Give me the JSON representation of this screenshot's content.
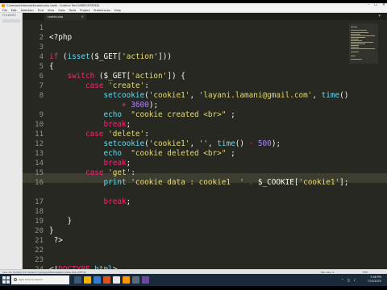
{
  "window": {
    "title": "C:\\xampp\\htdocs\\web\\cookie.php (web) - Sublime Text (UNREGISTERED)",
    "buttons": [
      "–",
      "☐",
      "✕"
    ]
  },
  "menu": [
    "File",
    "Edit",
    "Selection",
    "Find",
    "View",
    "Goto",
    "Tools",
    "Project",
    "Preferences",
    "Help"
  ],
  "sidebar": {
    "label": "FOLDERS"
  },
  "tab": {
    "label": "cookie.php",
    "close": "×"
  },
  "editor": {
    "current_line": 14,
    "lines": [
      {
        "n": "1",
        "segments": []
      },
      {
        "n": "2",
        "segments": [
          {
            "t": "<?php",
            "c": "w"
          }
        ]
      },
      {
        "n": "3",
        "segments": []
      },
      {
        "n": "4",
        "segments": [
          {
            "t": "if",
            "c": "k"
          },
          {
            "t": " (",
            "c": "w"
          },
          {
            "t": "isset",
            "c": "f"
          },
          {
            "t": "($_GET[",
            "c": "w"
          },
          {
            "t": "'action'",
            "c": "s"
          },
          {
            "t": "]))",
            "c": "w"
          }
        ]
      },
      {
        "n": "5",
        "segments": [
          {
            "t": "{",
            "c": "w"
          }
        ]
      },
      {
        "n": "6",
        "segments": [
          {
            "t": "    ",
            "c": "w"
          },
          {
            "t": "switch",
            "c": "k"
          },
          {
            "t": " ($_GET[",
            "c": "w"
          },
          {
            "t": "'action'",
            "c": "s"
          },
          {
            "t": "]) {",
            "c": "w"
          }
        ]
      },
      {
        "n": "7",
        "segments": [
          {
            "t": "        ",
            "c": "w"
          },
          {
            "t": "case",
            "c": "k"
          },
          {
            "t": " ",
            "c": "w"
          },
          {
            "t": "'create'",
            "c": "s"
          },
          {
            "t": ":",
            "c": "w"
          }
        ]
      },
      {
        "n": "8",
        "segments": [
          {
            "t": "            ",
            "c": "w"
          },
          {
            "t": "setcookie",
            "c": "f"
          },
          {
            "t": "(",
            "c": "w"
          },
          {
            "t": "'cookie1'",
            "c": "s"
          },
          {
            "t": ", ",
            "c": "w"
          },
          {
            "t": "'layani.lamani@gmail.com'",
            "c": "s"
          },
          {
            "t": ", ",
            "c": "w"
          },
          {
            "t": "time",
            "c": "f"
          },
          {
            "t": "()",
            "c": "w"
          }
        ]
      },
      {
        "n": "",
        "segments": [
          {
            "t": "                ",
            "c": "w"
          },
          {
            "t": "+",
            "c": "k"
          },
          {
            "t": " ",
            "c": "w"
          },
          {
            "t": "3600",
            "c": "n"
          },
          {
            "t": ");",
            "c": "w"
          }
        ]
      },
      {
        "n": "9",
        "segments": [
          {
            "t": "            ",
            "c": "w"
          },
          {
            "t": "echo",
            "c": "f"
          },
          {
            "t": "  ",
            "c": "w"
          },
          {
            "t": "\"cookie created <br>\"",
            "c": "s"
          },
          {
            "t": " ;",
            "c": "w"
          }
        ]
      },
      {
        "n": "10",
        "segments": [
          {
            "t": "            ",
            "c": "w"
          },
          {
            "t": "break",
            "c": "k"
          },
          {
            "t": ";",
            "c": "w"
          }
        ]
      },
      {
        "n": "11",
        "segments": [
          {
            "t": "        ",
            "c": "w"
          },
          {
            "t": "case",
            "c": "k"
          },
          {
            "t": " ",
            "c": "w"
          },
          {
            "t": "'delete'",
            "c": "s"
          },
          {
            "t": ":",
            "c": "w"
          }
        ]
      },
      {
        "n": "12",
        "segments": [
          {
            "t": "            ",
            "c": "w"
          },
          {
            "t": "setcookie",
            "c": "f"
          },
          {
            "t": "(",
            "c": "w"
          },
          {
            "t": "'cookie1'",
            "c": "s"
          },
          {
            "t": ", ",
            "c": "w"
          },
          {
            "t": "''",
            "c": "s"
          },
          {
            "t": ", ",
            "c": "w"
          },
          {
            "t": "time",
            "c": "f"
          },
          {
            "t": "() ",
            "c": "w"
          },
          {
            "t": "-",
            "c": "k"
          },
          {
            "t": " ",
            "c": "w"
          },
          {
            "t": "500",
            "c": "n"
          },
          {
            "t": ");",
            "c": "w"
          }
        ]
      },
      {
        "n": "13",
        "segments": [
          {
            "t": "            ",
            "c": "w"
          },
          {
            "t": "echo",
            "c": "f"
          },
          {
            "t": "  ",
            "c": "w"
          },
          {
            "t": "\"cookie deleted <br>\"",
            "c": "s"
          },
          {
            "t": " ;",
            "c": "w"
          }
        ]
      },
      {
        "n": "14",
        "segments": [
          {
            "t": "            ",
            "c": "w"
          },
          {
            "t": "break",
            "c": "k"
          },
          {
            "t": ";",
            "c": "w"
          }
        ]
      },
      {
        "n": "15",
        "segments": [
          {
            "t": "        ",
            "c": "w"
          },
          {
            "t": "case",
            "c": "k"
          },
          {
            "t": " ",
            "c": "w"
          },
          {
            "t": "'get'",
            "c": "s"
          },
          {
            "t": ":",
            "c": "w"
          }
        ]
      },
      {
        "n": "16",
        "segments": [
          {
            "t": "            ",
            "c": "w"
          },
          {
            "t": "print",
            "c": "f"
          },
          {
            "t": " ",
            "c": "w"
          },
          {
            "t": "'cookie data : cookie1  '",
            "c": "s"
          },
          {
            "t": " ",
            "c": "w"
          },
          {
            "t": ".",
            "c": "k"
          },
          {
            "t": " $_COOKIE[",
            "c": "w"
          },
          {
            "t": "'cookie1'",
            "c": "s"
          },
          {
            "t": "];",
            "c": "w"
          }
        ]
      },
      {
        "n": "",
        "segments": []
      },
      {
        "n": "17",
        "segments": [
          {
            "t": "            ",
            "c": "w"
          },
          {
            "t": "break",
            "c": "k"
          },
          {
            "t": ";",
            "c": "w"
          }
        ]
      },
      {
        "n": "18",
        "segments": []
      },
      {
        "n": "19",
        "segments": [
          {
            "t": "    }",
            "c": "w"
          }
        ]
      },
      {
        "n": "20",
        "segments": [
          {
            "t": "}",
            "c": "w"
          }
        ]
      },
      {
        "n": "21",
        "segments": [
          {
            "t": " ?>",
            "c": "w"
          }
        ]
      },
      {
        "n": "22",
        "segments": []
      },
      {
        "n": "23",
        "segments": []
      },
      {
        "n": "24",
        "segments": [
          {
            "t": "<!",
            "c": "w"
          },
          {
            "t": "DOCTYPE",
            "c": "k"
          },
          {
            "t": " ",
            "c": "w"
          },
          {
            "t": "html",
            "c": "f"
          },
          {
            "t": ">",
            "c": "w"
          }
        ]
      },
      {
        "n": "25",
        "segments": [
          {
            "t": "<",
            "c": "w"
          },
          {
            "t": "html",
            "c": "k"
          },
          {
            "t": ">",
            "c": "w"
          }
        ]
      },
      {
        "n": "26",
        "segments": [
          {
            "t": "<",
            "c": "w"
          },
          {
            "t": "head",
            "c": "k"
          },
          {
            "t": ">",
            "c": "w"
          }
        ]
      }
    ]
  },
  "statusbar": {
    "left": "Line 14, Column 23; Saved C:\\xampp\\htdocs\\web\\cookie.php (UTF-8)",
    "tab_size": "Tab Size: 4",
    "syntax": "PHP"
  },
  "taskbar": {
    "search_placeholder": "Type here to search",
    "time": "5:48 PM",
    "date": "7/10/2020"
  },
  "colors": {
    "editor_bg": "#272822",
    "keyword": "#f92672",
    "string": "#e6db74",
    "function": "#66d9ef",
    "number": "#ae81ff",
    "text": "#f8f8f2",
    "gutter_text": "#8f908a",
    "taskbar_bg": "#1a2a3a"
  }
}
